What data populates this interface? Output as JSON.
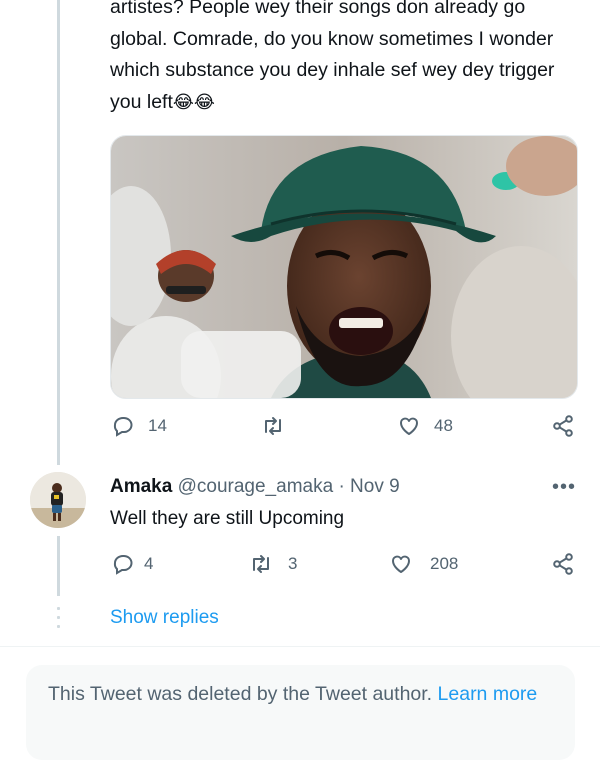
{
  "tweet": {
    "text": "artistes? People wey their songs don already go global. Comrade, do you know sometimes I wonder which substance you dey inhale sef wey dey trigger you left",
    "emoji": "😂😂",
    "image_alt": "Man in a green bucket hat crying",
    "actions": {
      "replies": "14",
      "retweets": "",
      "likes": "48"
    }
  },
  "reply": {
    "name": "Amaka",
    "handle": "@courage_amaka",
    "separator": "·",
    "date": "Nov 9",
    "text": "Well they are still Upcoming",
    "actions": {
      "replies": "4",
      "retweets": "3",
      "likes": "208"
    },
    "more": "•••"
  },
  "show_replies": "Show replies",
  "deleted_notice": {
    "text": "This Tweet was deleted by the Tweet author.",
    "link": "Learn more"
  },
  "colors": {
    "accent": "#1d9bf0",
    "muted": "#536471",
    "line": "#cfd9de"
  },
  "icons": [
    "reply-icon",
    "retweet-icon",
    "like-icon",
    "share-icon"
  ]
}
